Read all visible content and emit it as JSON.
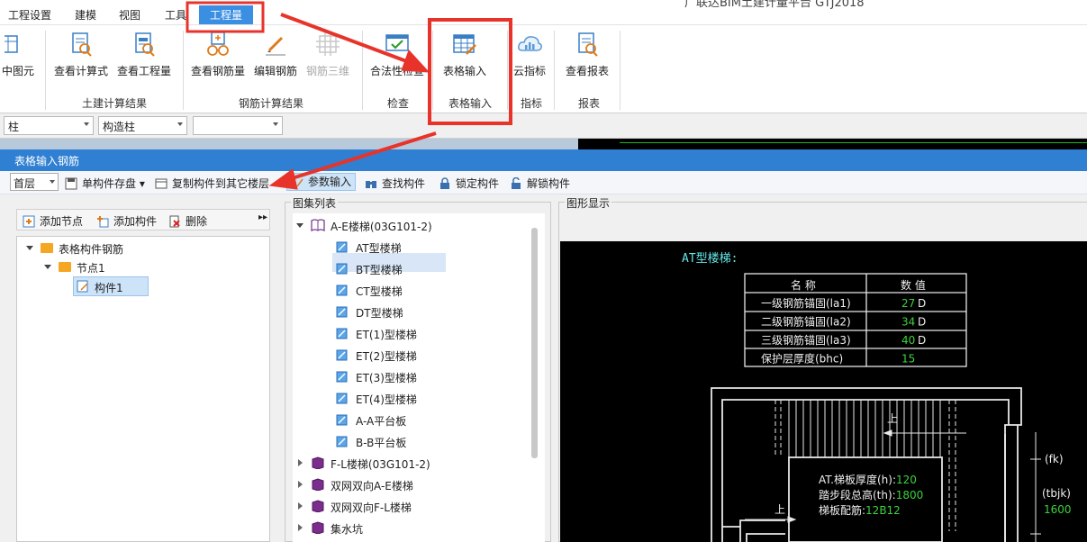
{
  "window": {
    "title_fragment": "广联达BIM土建计量平台 GTJ2018"
  },
  "menu": {
    "items": [
      "工程设置",
      "建模",
      "视图",
      "工具",
      "工程量"
    ],
    "active": "工程量"
  },
  "ribbon": {
    "buttons": {
      "partial": "中图元",
      "view_formula": "查看计算式",
      "view_quantity": "查看工程量",
      "view_rebar": "查看钢筋量",
      "edit_rebar": "编辑钢筋",
      "rebar_3d": "钢筋三维",
      "legality_check": "合法性检查",
      "table_input": "表格输入",
      "cloud_index": "云指标",
      "view_report": "查看报表"
    },
    "groups": {
      "civil": "土建计算结果",
      "rebar": "钢筋计算结果",
      "check": "检查",
      "table": "表格输入",
      "index": "指标",
      "report": "报表"
    }
  },
  "combos": {
    "category": "柱",
    "subtype": "构造柱",
    "third": ""
  },
  "dialog": {
    "title": "表格输入钢筋",
    "toolbar": {
      "floor": "首层",
      "save_single": "单构件存盘",
      "copy_to_floor": "复制构件到其它楼层",
      "param_input": "参数输入",
      "find": "查找构件",
      "lock": "锁定构件",
      "unlock": "解锁构件"
    },
    "left": {
      "toolbar": {
        "add_node": "添加节点",
        "add_member": "添加构件",
        "delete": "删除"
      },
      "tree": {
        "root": "表格构件钢筋",
        "node": "节点1",
        "member": "构件1"
      }
    },
    "atlas": {
      "caption": "图集列表",
      "group_open": "A-E楼梯(03G101-2)",
      "items": [
        "AT型楼梯",
        "BT型楼梯",
        "CT型楼梯",
        "DT型楼梯",
        "ET(1)型楼梯",
        "ET(2)型楼梯",
        "ET(3)型楼梯",
        "ET(4)型楼梯",
        "A-A平台板",
        "B-B平台板"
      ],
      "selected": "AT型楼梯",
      "collapsed": [
        "F-L楼梯(03G101-2)",
        "双网双向A-E楼梯",
        "双网双向F-L楼梯",
        "集水坑"
      ]
    },
    "graphic": {
      "caption": "图形显示",
      "heading": "AT型楼梯:",
      "table": {
        "headers": [
          "名  称",
          "数  值"
        ],
        "rows": [
          {
            "name": "一级钢筋锚固(la1)",
            "value": "27",
            "unit": "D"
          },
          {
            "name": "二级钢筋锚固(la2)",
            "value": "34",
            "unit": "D"
          },
          {
            "name": "三级钢筋锚固(la3)",
            "value": "40",
            "unit": "D"
          },
          {
            "name": "保护层厚度(bhc)",
            "value": "15",
            "unit": ""
          }
        ]
      },
      "params": [
        {
          "label": "AT.梯板厚度(h):",
          "value": "120"
        },
        {
          "label": "踏步段总高(th):",
          "value": "1800"
        },
        {
          "label": "梯板配筋:",
          "value": "12B12"
        }
      ],
      "up_label": "上",
      "dims": {
        "fk": "(fk)",
        "tbjk": "(tbjk)",
        "tbjk_value": "1600"
      }
    }
  },
  "colors": {
    "accent": "#2f7fd2",
    "highlight_red": "#e8332a",
    "cad_green": "#3bd33b",
    "cad_cyan": "#64e6e6"
  }
}
